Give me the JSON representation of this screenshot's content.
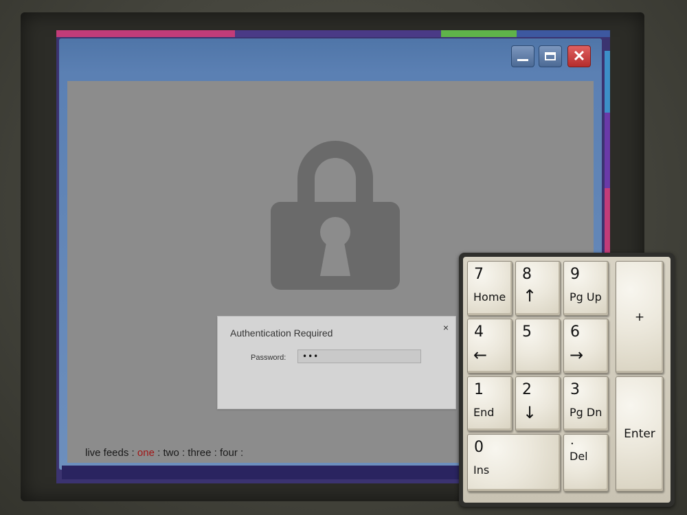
{
  "dialog": {
    "title": "Authentication Required",
    "close_glyph": "×",
    "password_label": "Password:",
    "password_value": "•••"
  },
  "live_feeds": {
    "label": "live feeds :",
    "items": [
      "one",
      "two",
      "three",
      "four"
    ],
    "separator": ":",
    "active": "one"
  },
  "window_buttons": {
    "close_glyph": "✕"
  },
  "keypad": {
    "keys": [
      {
        "main": "7",
        "sub": "Home"
      },
      {
        "main": "8",
        "arrow": "↑"
      },
      {
        "main": "9",
        "sub": "Pg Up"
      },
      {
        "main": "+"
      },
      {
        "main": "4",
        "arrow": "←"
      },
      {
        "main": "5"
      },
      {
        "main": "6",
        "arrow": "→"
      },
      {
        "main": "1",
        "sub": "End"
      },
      {
        "main": "2",
        "arrow": "↓"
      },
      {
        "main": "3",
        "sub": "Pg Dn"
      },
      {
        "main": "Enter"
      },
      {
        "main": "0",
        "sub": "Ins"
      },
      {
        "main": ".",
        "sub": "Del"
      }
    ]
  },
  "icons": {
    "lock": "padlock-icon"
  },
  "colors": {
    "active_feed": "#a01616",
    "close_button": "#c83a3a",
    "window_frame": "#5b80b3",
    "content_bg": "#8c8c8c",
    "lock_icon": "#6a6a6a"
  }
}
